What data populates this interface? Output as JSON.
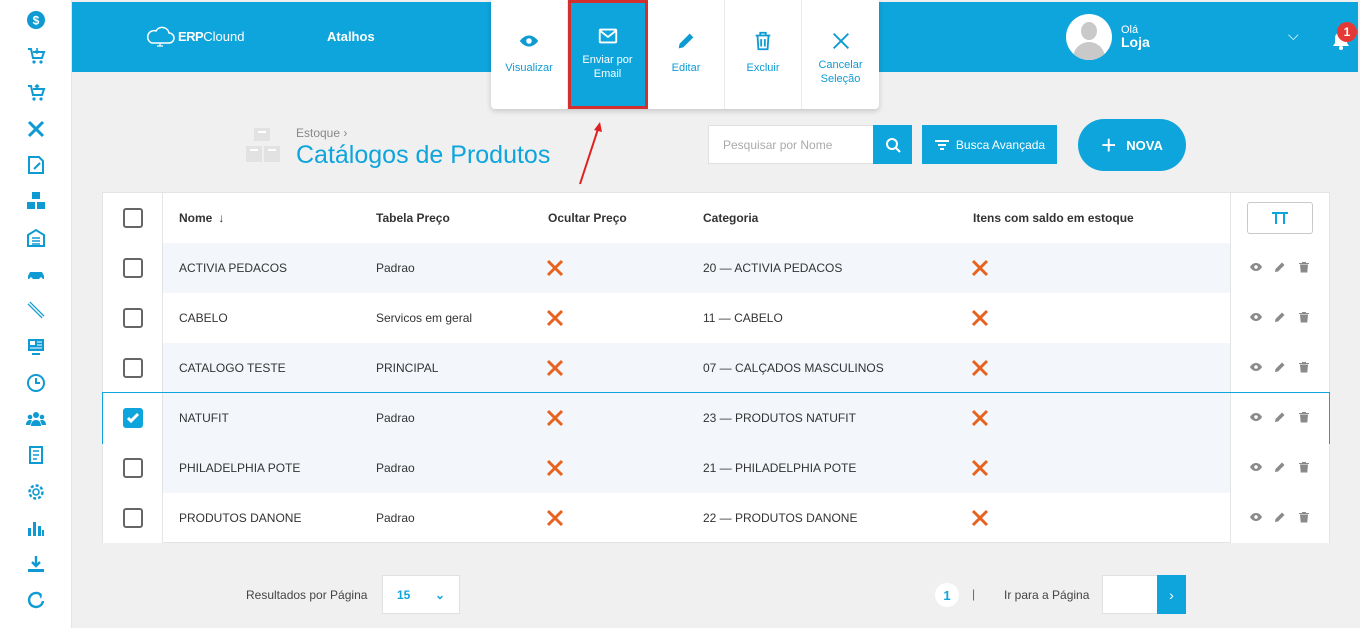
{
  "sidebar": {
    "items": [
      {
        "icon": "dollar-icon"
      },
      {
        "icon": "cart-in-icon"
      },
      {
        "icon": "cart-out-icon"
      },
      {
        "icon": "tools-icon"
      },
      {
        "icon": "edit-note-icon"
      },
      {
        "icon": "boxes-icon"
      },
      {
        "icon": "warehouse-icon"
      },
      {
        "icon": "car-icon"
      },
      {
        "icon": "pencil-icon"
      },
      {
        "icon": "monitor-icon"
      },
      {
        "icon": "clock-icon"
      },
      {
        "icon": "users-icon"
      },
      {
        "icon": "invoice-icon"
      },
      {
        "icon": "gear-icon"
      },
      {
        "icon": "bar-chart-icon"
      },
      {
        "icon": "download-icon"
      },
      {
        "icon": "refresh-icon"
      }
    ]
  },
  "header": {
    "logo_prefix": "ERP",
    "logo_suffix": "Clound",
    "shortcuts_label": "Atalhos",
    "greeting": "Olá",
    "user_name": "Loja",
    "notification_count": "1"
  },
  "actions": {
    "view": "Visualizar",
    "email": "Enviar por Email",
    "edit": "Editar",
    "delete": "Excluir",
    "cancel": "Cancelar Seleção"
  },
  "page": {
    "breadcrumb": "Estoque",
    "title": "Catálogos de Produtos",
    "search_placeholder": "Pesquisar por Nome",
    "advanced_search": "Busca Avançada",
    "new_button": "NOVA"
  },
  "table": {
    "headers": {
      "name": "Nome",
      "price_table": "Tabela Preço",
      "hide_price": "Ocultar Preço",
      "category": "Categoria",
      "stock_items": "Itens com saldo em estoque"
    },
    "rows": [
      {
        "name": "ACTIVIA PEDACOS",
        "price_table": "Padrao",
        "category": "20 — ACTIVIA PEDACOS",
        "checked": false
      },
      {
        "name": "CABELO",
        "price_table": "Servicos em geral",
        "category": "11 — CABELO",
        "checked": false
      },
      {
        "name": "CATALOGO TESTE",
        "price_table": "PRINCIPAL",
        "category": "07 — CALÇADOS MASCULINOS",
        "checked": false
      },
      {
        "name": "NATUFIT",
        "price_table": "Padrao",
        "category": "23 — PRODUTOS NATUFIT",
        "checked": true
      },
      {
        "name": "PHILADELPHIA POTE",
        "price_table": "Padrao",
        "category": "21 — PHILADELPHIA POTE",
        "checked": false
      },
      {
        "name": "PRODUTOS DANONE",
        "price_table": "Padrao",
        "category": "22 — PRODUTOS DANONE",
        "checked": false
      }
    ]
  },
  "footer": {
    "results_label": "Resultados por Página",
    "results_value": "15",
    "current_page": "1",
    "separator": "|",
    "goto_label": "Ir para a Página"
  },
  "colors": {
    "primary": "#0ea5dc",
    "x_mark": "#e8621f",
    "highlight": "#d32f2f"
  }
}
